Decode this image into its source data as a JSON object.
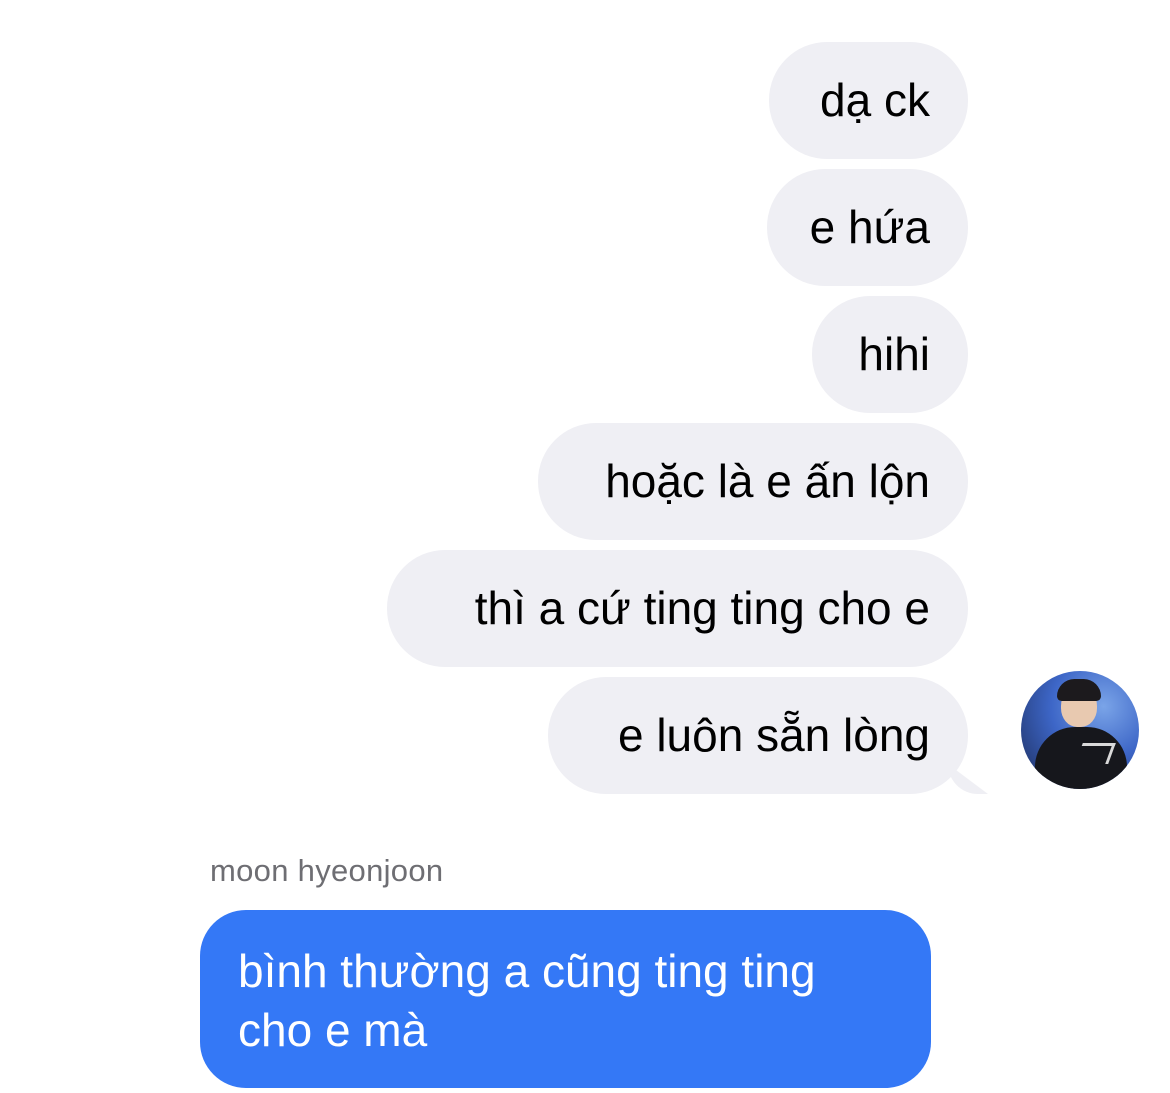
{
  "messages_sent": [
    {
      "text": "dạ ck"
    },
    {
      "text": "e hứa"
    },
    {
      "text": "hihi"
    },
    {
      "text": "hoặc là e ấn lộn"
    },
    {
      "text": "thì a cứ ting ting cho e"
    },
    {
      "text": "e luôn sẵn lòng"
    }
  ],
  "incoming": {
    "sender_name": "moon hyeonjoon",
    "text_line1": "bình thường a cũng ting ting",
    "text_line2": "cho e mà"
  },
  "colors": {
    "gray_bubble": "#efeff4",
    "blue_bubble": "#3478f6",
    "sender_label": "#6e6e73"
  },
  "avatar": {
    "icon": "profile-photo"
  }
}
